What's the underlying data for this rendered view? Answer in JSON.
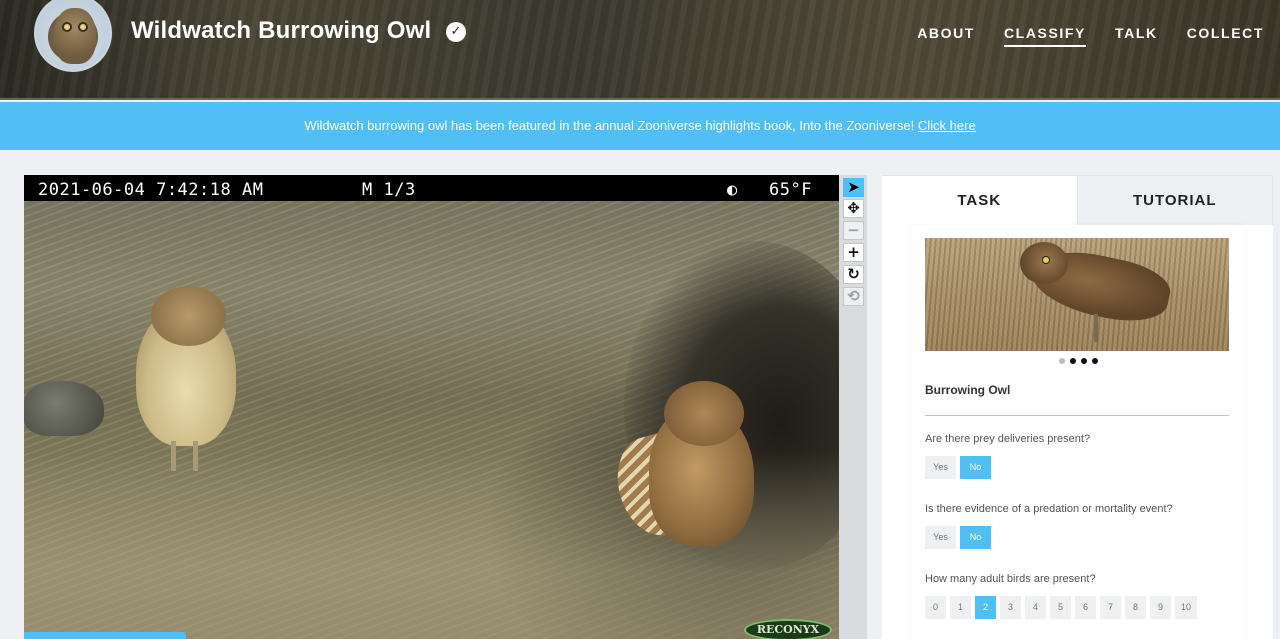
{
  "header": {
    "title": "Wildwatch Burrowing Owl",
    "verified_icon": "check-circle-icon",
    "nav": [
      {
        "label": "ABOUT",
        "active": false
      },
      {
        "label": "CLASSIFY",
        "active": true
      },
      {
        "label": "TALK",
        "active": false
      },
      {
        "label": "COLLECT",
        "active": false
      }
    ]
  },
  "banner": {
    "text": "Wildwatch burrowing owl has been featured in the annual Zooniverse highlights book, Into the Zooniverse!",
    "link": "Click here"
  },
  "viewer": {
    "datetime": "2021-06-04 7:42:18 AM",
    "mode": "M 1/3",
    "moon": "◐",
    "temperature": "65°F",
    "brand": "RECONYX"
  },
  "toolbar": {
    "tools": [
      {
        "name": "pointer-icon",
        "glyph": "➤"
      },
      {
        "name": "move-icon",
        "glyph": "✥"
      },
      {
        "name": "zoom-out-icon",
        "glyph": "−"
      },
      {
        "name": "zoom-in-icon",
        "glyph": "+"
      },
      {
        "name": "rotate-icon",
        "glyph": "↻"
      },
      {
        "name": "reset-icon",
        "glyph": "⟲"
      }
    ]
  },
  "panel": {
    "tabs": [
      {
        "label": "TASK",
        "active": true
      },
      {
        "label": "TUTORIAL",
        "active": false
      }
    ],
    "species": "Burrowing Owl",
    "questions": [
      {
        "text": "Are there prey deliveries present?",
        "options": [
          "Yes",
          "No"
        ],
        "selected": "No"
      },
      {
        "text": "Is there evidence of a predation or mortality event?",
        "options": [
          "Yes",
          "No"
        ],
        "selected": "No"
      },
      {
        "text": "How many adult birds are present?",
        "options": [
          "0",
          "1",
          "2",
          "3",
          "4",
          "5",
          "6",
          "7",
          "8",
          "9",
          "10"
        ],
        "selected": "2"
      }
    ]
  },
  "colors": {
    "accent": "#4fbff5",
    "banner": "#4fbff5",
    "header_bg": "#3b3a2e"
  }
}
